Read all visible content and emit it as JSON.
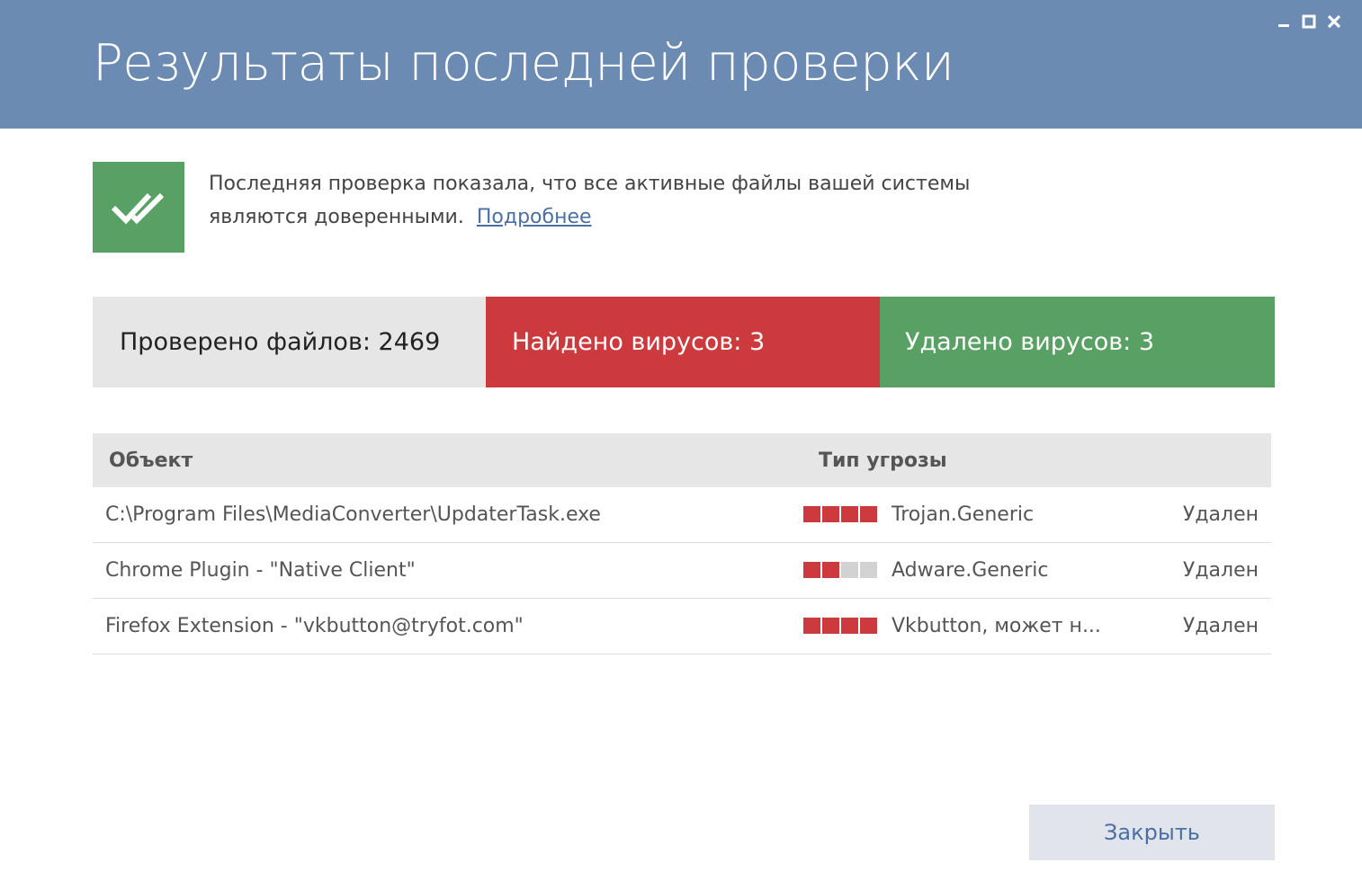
{
  "window": {
    "title": "Результаты последней проверки",
    "header_color": "#6c8bb2"
  },
  "status": {
    "icon": "double-check-icon",
    "color": "#58a063",
    "message_line1": "Последняя проверка показала, что все активные файлы вашей системы",
    "message_line2": "являются доверенными.",
    "link": "Подробнее"
  },
  "summary": {
    "checked": "Проверено файлов: 2469",
    "found": "Найдено вирусов: 3",
    "removed": "Удалено вирусов: 3",
    "colors": {
      "checked": "#e6e6e6",
      "found": "#cc3a3d",
      "removed": "#58a063"
    }
  },
  "table": {
    "columns": [
      "Объект",
      "Тип угрозы"
    ],
    "rows": [
      {
        "object": "C:\\Program Files\\MediaConverter\\UpdaterTask.exe",
        "severity": 4,
        "severity_max": 4,
        "threat": "Trojan.Generic",
        "status": "Удален"
      },
      {
        "object": "Chrome Plugin - \"Native Client\"",
        "severity": 2,
        "severity_max": 4,
        "threat": "Adware.Generic",
        "status": "Удален"
      },
      {
        "object": "Firefox Extension - \"vkbutton@tryfot.com\"",
        "severity": 4,
        "severity_max": 4,
        "threat": "Vkbutton, может н...",
        "status": "Удален"
      }
    ]
  },
  "footer": {
    "close_label": "Закрыть"
  }
}
